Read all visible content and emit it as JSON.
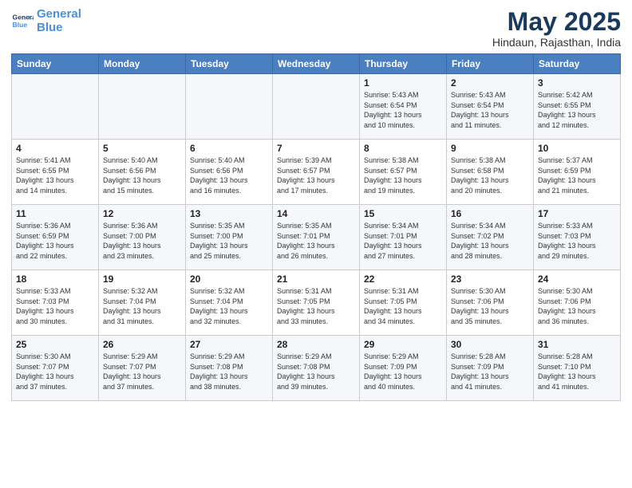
{
  "logo": {
    "line1": "General",
    "line2": "Blue"
  },
  "title": "May 2025",
  "subtitle": "Hindaun, Rajasthan, India",
  "days_of_week": [
    "Sunday",
    "Monday",
    "Tuesday",
    "Wednesday",
    "Thursday",
    "Friday",
    "Saturday"
  ],
  "weeks": [
    [
      {
        "day": "",
        "info": ""
      },
      {
        "day": "",
        "info": ""
      },
      {
        "day": "",
        "info": ""
      },
      {
        "day": "",
        "info": ""
      },
      {
        "day": "1",
        "info": "Sunrise: 5:43 AM\nSunset: 6:54 PM\nDaylight: 13 hours\nand 10 minutes."
      },
      {
        "day": "2",
        "info": "Sunrise: 5:43 AM\nSunset: 6:54 PM\nDaylight: 13 hours\nand 11 minutes."
      },
      {
        "day": "3",
        "info": "Sunrise: 5:42 AM\nSunset: 6:55 PM\nDaylight: 13 hours\nand 12 minutes."
      }
    ],
    [
      {
        "day": "4",
        "info": "Sunrise: 5:41 AM\nSunset: 6:55 PM\nDaylight: 13 hours\nand 14 minutes."
      },
      {
        "day": "5",
        "info": "Sunrise: 5:40 AM\nSunset: 6:56 PM\nDaylight: 13 hours\nand 15 minutes."
      },
      {
        "day": "6",
        "info": "Sunrise: 5:40 AM\nSunset: 6:56 PM\nDaylight: 13 hours\nand 16 minutes."
      },
      {
        "day": "7",
        "info": "Sunrise: 5:39 AM\nSunset: 6:57 PM\nDaylight: 13 hours\nand 17 minutes."
      },
      {
        "day": "8",
        "info": "Sunrise: 5:38 AM\nSunset: 6:57 PM\nDaylight: 13 hours\nand 19 minutes."
      },
      {
        "day": "9",
        "info": "Sunrise: 5:38 AM\nSunset: 6:58 PM\nDaylight: 13 hours\nand 20 minutes."
      },
      {
        "day": "10",
        "info": "Sunrise: 5:37 AM\nSunset: 6:59 PM\nDaylight: 13 hours\nand 21 minutes."
      }
    ],
    [
      {
        "day": "11",
        "info": "Sunrise: 5:36 AM\nSunset: 6:59 PM\nDaylight: 13 hours\nand 22 minutes."
      },
      {
        "day": "12",
        "info": "Sunrise: 5:36 AM\nSunset: 7:00 PM\nDaylight: 13 hours\nand 23 minutes."
      },
      {
        "day": "13",
        "info": "Sunrise: 5:35 AM\nSunset: 7:00 PM\nDaylight: 13 hours\nand 25 minutes."
      },
      {
        "day": "14",
        "info": "Sunrise: 5:35 AM\nSunset: 7:01 PM\nDaylight: 13 hours\nand 26 minutes."
      },
      {
        "day": "15",
        "info": "Sunrise: 5:34 AM\nSunset: 7:01 PM\nDaylight: 13 hours\nand 27 minutes."
      },
      {
        "day": "16",
        "info": "Sunrise: 5:34 AM\nSunset: 7:02 PM\nDaylight: 13 hours\nand 28 minutes."
      },
      {
        "day": "17",
        "info": "Sunrise: 5:33 AM\nSunset: 7:03 PM\nDaylight: 13 hours\nand 29 minutes."
      }
    ],
    [
      {
        "day": "18",
        "info": "Sunrise: 5:33 AM\nSunset: 7:03 PM\nDaylight: 13 hours\nand 30 minutes."
      },
      {
        "day": "19",
        "info": "Sunrise: 5:32 AM\nSunset: 7:04 PM\nDaylight: 13 hours\nand 31 minutes."
      },
      {
        "day": "20",
        "info": "Sunrise: 5:32 AM\nSunset: 7:04 PM\nDaylight: 13 hours\nand 32 minutes."
      },
      {
        "day": "21",
        "info": "Sunrise: 5:31 AM\nSunset: 7:05 PM\nDaylight: 13 hours\nand 33 minutes."
      },
      {
        "day": "22",
        "info": "Sunrise: 5:31 AM\nSunset: 7:05 PM\nDaylight: 13 hours\nand 34 minutes."
      },
      {
        "day": "23",
        "info": "Sunrise: 5:30 AM\nSunset: 7:06 PM\nDaylight: 13 hours\nand 35 minutes."
      },
      {
        "day": "24",
        "info": "Sunrise: 5:30 AM\nSunset: 7:06 PM\nDaylight: 13 hours\nand 36 minutes."
      }
    ],
    [
      {
        "day": "25",
        "info": "Sunrise: 5:30 AM\nSunset: 7:07 PM\nDaylight: 13 hours\nand 37 minutes."
      },
      {
        "day": "26",
        "info": "Sunrise: 5:29 AM\nSunset: 7:07 PM\nDaylight: 13 hours\nand 37 minutes."
      },
      {
        "day": "27",
        "info": "Sunrise: 5:29 AM\nSunset: 7:08 PM\nDaylight: 13 hours\nand 38 minutes."
      },
      {
        "day": "28",
        "info": "Sunrise: 5:29 AM\nSunset: 7:08 PM\nDaylight: 13 hours\nand 39 minutes."
      },
      {
        "day": "29",
        "info": "Sunrise: 5:29 AM\nSunset: 7:09 PM\nDaylight: 13 hours\nand 40 minutes."
      },
      {
        "day": "30",
        "info": "Sunrise: 5:28 AM\nSunset: 7:09 PM\nDaylight: 13 hours\nand 41 minutes."
      },
      {
        "day": "31",
        "info": "Sunrise: 5:28 AM\nSunset: 7:10 PM\nDaylight: 13 hours\nand 41 minutes."
      }
    ]
  ]
}
